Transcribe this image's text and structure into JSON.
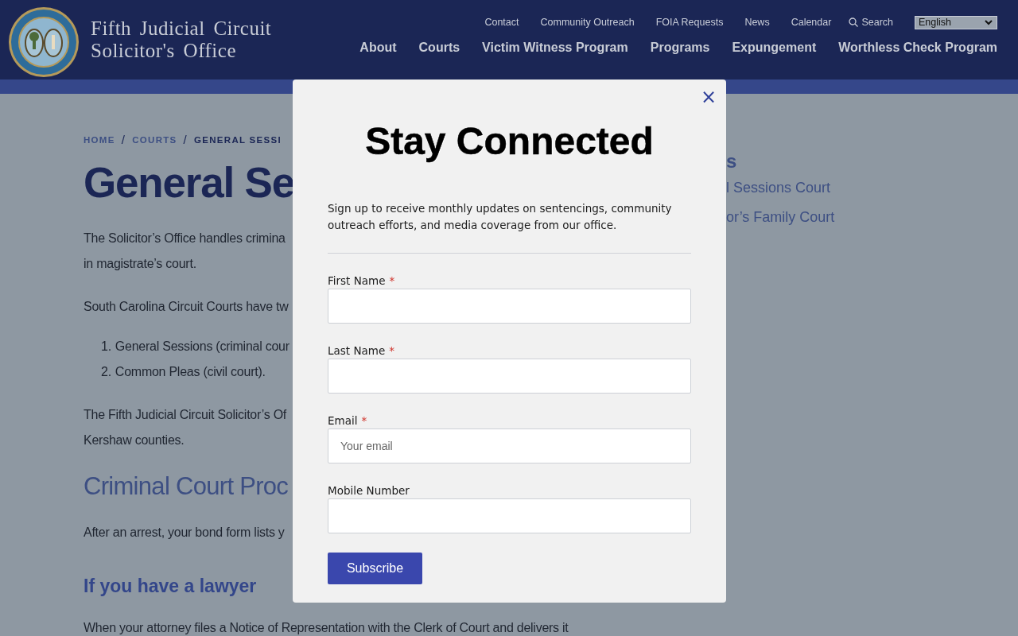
{
  "site": {
    "title_line_1": "Fifth Judicial Circuit",
    "title_line_2": "Solicitor's Office"
  },
  "utility_nav": [
    {
      "label": "Contact"
    },
    {
      "label": "Community Outreach"
    },
    {
      "label": "FOIA Requests"
    },
    {
      "label": "News"
    },
    {
      "label": "Calendar"
    },
    {
      "label": "Search",
      "kind": "search"
    }
  ],
  "language_select": {
    "value": "English"
  },
  "main_nav": [
    {
      "label": "About"
    },
    {
      "label": "Courts"
    },
    {
      "label": "Victim Witness Program"
    },
    {
      "label": "Programs"
    },
    {
      "label": "Expungement"
    },
    {
      "label": "Worthless Check Program"
    }
  ],
  "breadcrumb": [
    {
      "label": "HOME",
      "current": false
    },
    {
      "label": "COURTS",
      "current": false
    },
    {
      "label": "GENERAL SESSI",
      "current": true
    }
  ],
  "breadcrumb_separator": "/",
  "page_title": "General Se",
  "content": [
    {
      "kind": "paragraph",
      "lines": [
        "The Solicitor’s Office handles crimina",
        "in magistrate’s court."
      ]
    },
    {
      "kind": "paragraph",
      "lines": [
        "South Carolina Circuit Courts have tw"
      ]
    },
    {
      "kind": "list",
      "items": [
        {
          "number": "1.",
          "text": "General Sessions (criminal cour"
        },
        {
          "number": "2.",
          "text": "Common Pleas (civil court)."
        }
      ]
    },
    {
      "kind": "paragraph",
      "lines": [
        "The Fifth Judicial Circuit Solicitor’s Of",
        "Kershaw counties."
      ]
    },
    {
      "kind": "heading",
      "text": "Criminal Court Proc"
    },
    {
      "kind": "paragraph",
      "lines": [
        "After an arrest, your bond form lists y"
      ]
    },
    {
      "kind": "subheading",
      "text": "If you have a lawyer"
    },
    {
      "kind": "paragraph",
      "lines": [
        "When your attorney files a Notice of Representation with the Clerk of Court and delivers it"
      ]
    }
  ],
  "sidebar": {
    "heading": "s",
    "links": [
      "l Sessions Court",
      "or’s Family Court"
    ]
  },
  "modal": {
    "close": "×",
    "title": "Stay Connected",
    "intro": "Sign up to receive monthly updates on sentencings, community outreach efforts, and media coverage from our office.",
    "fields": [
      {
        "label": "First Name",
        "marker": "*"
      },
      {
        "label": "Last Name",
        "marker": "*"
      },
      {
        "label": "Email",
        "marker": "*",
        "placeholder": "Your email"
      },
      {
        "label": "Mobile Number"
      }
    ],
    "button": "Subscribe"
  }
}
